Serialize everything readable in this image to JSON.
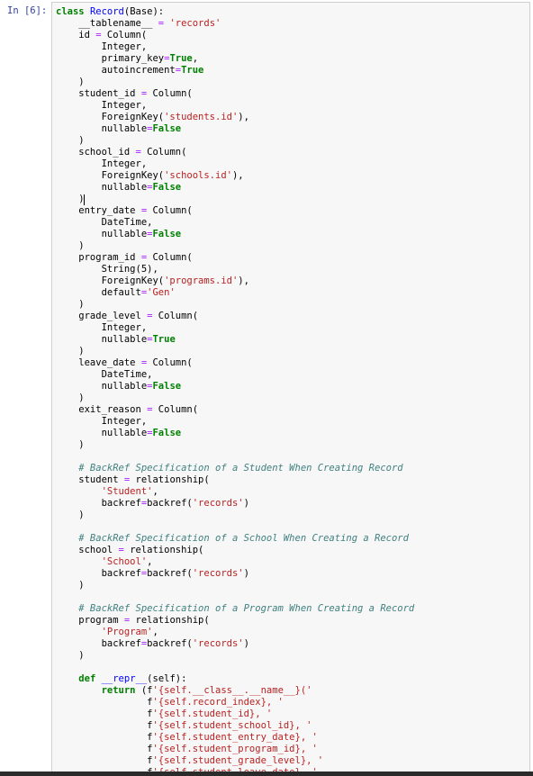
{
  "cell": {
    "prompt": "In [6]:",
    "lines": [
      [
        {
          "t": "class ",
          "c": "kw"
        },
        {
          "t": "Record",
          "c": "def"
        },
        {
          "t": "(Base):",
          "c": "pl"
        }
      ],
      [
        {
          "t": "    __tablename__ ",
          "c": "pl"
        },
        {
          "t": "=",
          "c": "op"
        },
        {
          "t": " ",
          "c": "pl"
        },
        {
          "t": "'records'",
          "c": "str"
        }
      ],
      [
        {
          "t": "    id ",
          "c": "pl"
        },
        {
          "t": "=",
          "c": "op"
        },
        {
          "t": " Column(",
          "c": "pl"
        }
      ],
      [
        {
          "t": "        Integer,",
          "c": "pl"
        }
      ],
      [
        {
          "t": "        primary_key",
          "c": "pl"
        },
        {
          "t": "=",
          "c": "op"
        },
        {
          "t": "True",
          "c": "const"
        },
        {
          "t": ",",
          "c": "pl"
        }
      ],
      [
        {
          "t": "        autoincrement",
          "c": "pl"
        },
        {
          "t": "=",
          "c": "op"
        },
        {
          "t": "True",
          "c": "const"
        }
      ],
      [
        {
          "t": "    )",
          "c": "pl"
        }
      ],
      [
        {
          "t": "    student_id ",
          "c": "pl"
        },
        {
          "t": "=",
          "c": "op"
        },
        {
          "t": " Column(",
          "c": "pl"
        }
      ],
      [
        {
          "t": "        Integer,",
          "c": "pl"
        }
      ],
      [
        {
          "t": "        ForeignKey(",
          "c": "pl"
        },
        {
          "t": "'students.id'",
          "c": "str"
        },
        {
          "t": "),",
          "c": "pl"
        }
      ],
      [
        {
          "t": "        nullable",
          "c": "pl"
        },
        {
          "t": "=",
          "c": "op"
        },
        {
          "t": "False",
          "c": "const"
        }
      ],
      [
        {
          "t": "    )",
          "c": "pl"
        }
      ],
      [
        {
          "t": "    school_id ",
          "c": "pl"
        },
        {
          "t": "=",
          "c": "op"
        },
        {
          "t": " Column(",
          "c": "pl"
        }
      ],
      [
        {
          "t": "        Integer,",
          "c": "pl"
        }
      ],
      [
        {
          "t": "        ForeignKey(",
          "c": "pl"
        },
        {
          "t": "'schools.id'",
          "c": "str"
        },
        {
          "t": "),",
          "c": "pl"
        }
      ],
      [
        {
          "t": "        nullable",
          "c": "pl"
        },
        {
          "t": "=",
          "c": "op"
        },
        {
          "t": "False",
          "c": "const"
        }
      ],
      [
        {
          "t": "    )",
          "c": "pl"
        }
      ],
      [
        {
          "t": "    entry_date ",
          "c": "pl"
        },
        {
          "t": "=",
          "c": "op"
        },
        {
          "t": " Column(",
          "c": "pl"
        }
      ],
      [
        {
          "t": "        DateTime,",
          "c": "pl"
        }
      ],
      [
        {
          "t": "        nullable",
          "c": "pl"
        },
        {
          "t": "=",
          "c": "op"
        },
        {
          "t": "False",
          "c": "const"
        }
      ],
      [
        {
          "t": "    )",
          "c": "pl"
        }
      ],
      [
        {
          "t": "    program_id ",
          "c": "pl"
        },
        {
          "t": "=",
          "c": "op"
        },
        {
          "t": " Column(",
          "c": "pl"
        }
      ],
      [
        {
          "t": "        String(5),",
          "c": "pl"
        }
      ],
      [
        {
          "t": "        ForeignKey(",
          "c": "pl"
        },
        {
          "t": "'programs.id'",
          "c": "str"
        },
        {
          "t": "),",
          "c": "pl"
        }
      ],
      [
        {
          "t": "        default",
          "c": "pl"
        },
        {
          "t": "=",
          "c": "op"
        },
        {
          "t": "'Gen'",
          "c": "str"
        }
      ],
      [
        {
          "t": "    )",
          "c": "pl"
        }
      ],
      [
        {
          "t": "    grade_level ",
          "c": "pl"
        },
        {
          "t": "=",
          "c": "op"
        },
        {
          "t": " Column(",
          "c": "pl"
        }
      ],
      [
        {
          "t": "        Integer,",
          "c": "pl"
        }
      ],
      [
        {
          "t": "        nullable",
          "c": "pl"
        },
        {
          "t": "=",
          "c": "op"
        },
        {
          "t": "True",
          "c": "const"
        }
      ],
      [
        {
          "t": "    )",
          "c": "pl"
        }
      ],
      [
        {
          "t": "    leave_date ",
          "c": "pl"
        },
        {
          "t": "=",
          "c": "op"
        },
        {
          "t": " Column(",
          "c": "pl"
        }
      ],
      [
        {
          "t": "        DateTime,",
          "c": "pl"
        }
      ],
      [
        {
          "t": "        nullable",
          "c": "pl"
        },
        {
          "t": "=",
          "c": "op"
        },
        {
          "t": "False",
          "c": "const"
        }
      ],
      [
        {
          "t": "    )",
          "c": "pl"
        }
      ],
      [
        {
          "t": "    exit_reason ",
          "c": "pl"
        },
        {
          "t": "=",
          "c": "op"
        },
        {
          "t": " Column(",
          "c": "pl"
        }
      ],
      [
        {
          "t": "        Integer,",
          "c": "pl"
        }
      ],
      [
        {
          "t": "        nullable",
          "c": "pl"
        },
        {
          "t": "=",
          "c": "op"
        },
        {
          "t": "False",
          "c": "const"
        }
      ],
      [
        {
          "t": "    )",
          "c": "pl"
        }
      ],
      [
        {
          "t": "",
          "c": "pl"
        }
      ],
      [
        {
          "t": "    # BackRef Specification of a Student When Creating Record",
          "c": "com"
        }
      ],
      [
        {
          "t": "    student ",
          "c": "pl"
        },
        {
          "t": "=",
          "c": "op"
        },
        {
          "t": " relationship(",
          "c": "pl"
        }
      ],
      [
        {
          "t": "        ",
          "c": "pl"
        },
        {
          "t": "'Student'",
          "c": "str"
        },
        {
          "t": ",",
          "c": "pl"
        }
      ],
      [
        {
          "t": "        backref",
          "c": "pl"
        },
        {
          "t": "=",
          "c": "op"
        },
        {
          "t": "backref(",
          "c": "pl"
        },
        {
          "t": "'records'",
          "c": "str"
        },
        {
          "t": ")",
          "c": "pl"
        }
      ],
      [
        {
          "t": "    )",
          "c": "pl"
        }
      ],
      [
        {
          "t": "",
          "c": "pl"
        }
      ],
      [
        {
          "t": "    # BackRef Specification of a School When Creating a Record",
          "c": "com"
        }
      ],
      [
        {
          "t": "    school ",
          "c": "pl"
        },
        {
          "t": "=",
          "c": "op"
        },
        {
          "t": " relationship(",
          "c": "pl"
        }
      ],
      [
        {
          "t": "        ",
          "c": "pl"
        },
        {
          "t": "'School'",
          "c": "str"
        },
        {
          "t": ",",
          "c": "pl"
        }
      ],
      [
        {
          "t": "        backref",
          "c": "pl"
        },
        {
          "t": "=",
          "c": "op"
        },
        {
          "t": "backref(",
          "c": "pl"
        },
        {
          "t": "'records'",
          "c": "str"
        },
        {
          "t": ")",
          "c": "pl"
        }
      ],
      [
        {
          "t": "    )",
          "c": "pl"
        }
      ],
      [
        {
          "t": "",
          "c": "pl"
        }
      ],
      [
        {
          "t": "    # BackRef Specification of a Program When Creating a Record",
          "c": "com"
        }
      ],
      [
        {
          "t": "    program ",
          "c": "pl"
        },
        {
          "t": "=",
          "c": "op"
        },
        {
          "t": " relationship(",
          "c": "pl"
        }
      ],
      [
        {
          "t": "        ",
          "c": "pl"
        },
        {
          "t": "'Program'",
          "c": "str"
        },
        {
          "t": ",",
          "c": "pl"
        }
      ],
      [
        {
          "t": "        backref",
          "c": "pl"
        },
        {
          "t": "=",
          "c": "op"
        },
        {
          "t": "backref(",
          "c": "pl"
        },
        {
          "t": "'records'",
          "c": "str"
        },
        {
          "t": ")",
          "c": "pl"
        }
      ],
      [
        {
          "t": "    )",
          "c": "pl"
        }
      ],
      [
        {
          "t": "",
          "c": "pl"
        }
      ],
      [
        {
          "t": "    ",
          "c": "pl"
        },
        {
          "t": "def ",
          "c": "kw"
        },
        {
          "t": "__repr__",
          "c": "def"
        },
        {
          "t": "(self):",
          "c": "pl"
        }
      ],
      [
        {
          "t": "        ",
          "c": "pl"
        },
        {
          "t": "return ",
          "c": "kw"
        },
        {
          "t": "(f",
          "c": "pl"
        },
        {
          "t": "'{self.__class__.__name__}('",
          "c": "str"
        }
      ],
      [
        {
          "t": "                f",
          "c": "pl"
        },
        {
          "t": "'{self.record_index}, '",
          "c": "str"
        }
      ],
      [
        {
          "t": "                f",
          "c": "pl"
        },
        {
          "t": "'{self.student_id}, '",
          "c": "str"
        }
      ],
      [
        {
          "t": "                f",
          "c": "pl"
        },
        {
          "t": "'{self.student_school_id}, '",
          "c": "str"
        }
      ],
      [
        {
          "t": "                f",
          "c": "pl"
        },
        {
          "t": "'{self.student_entry_date}, '",
          "c": "str"
        }
      ],
      [
        {
          "t": "                f",
          "c": "pl"
        },
        {
          "t": "'{self.student_program_id}, '",
          "c": "str"
        }
      ],
      [
        {
          "t": "                f",
          "c": "pl"
        },
        {
          "t": "'{self.student_grade_level}, '",
          "c": "str"
        }
      ],
      [
        {
          "t": "                f",
          "c": "pl"
        },
        {
          "t": "'{self.student_leave_date}, '",
          "c": "str"
        }
      ]
    ]
  }
}
